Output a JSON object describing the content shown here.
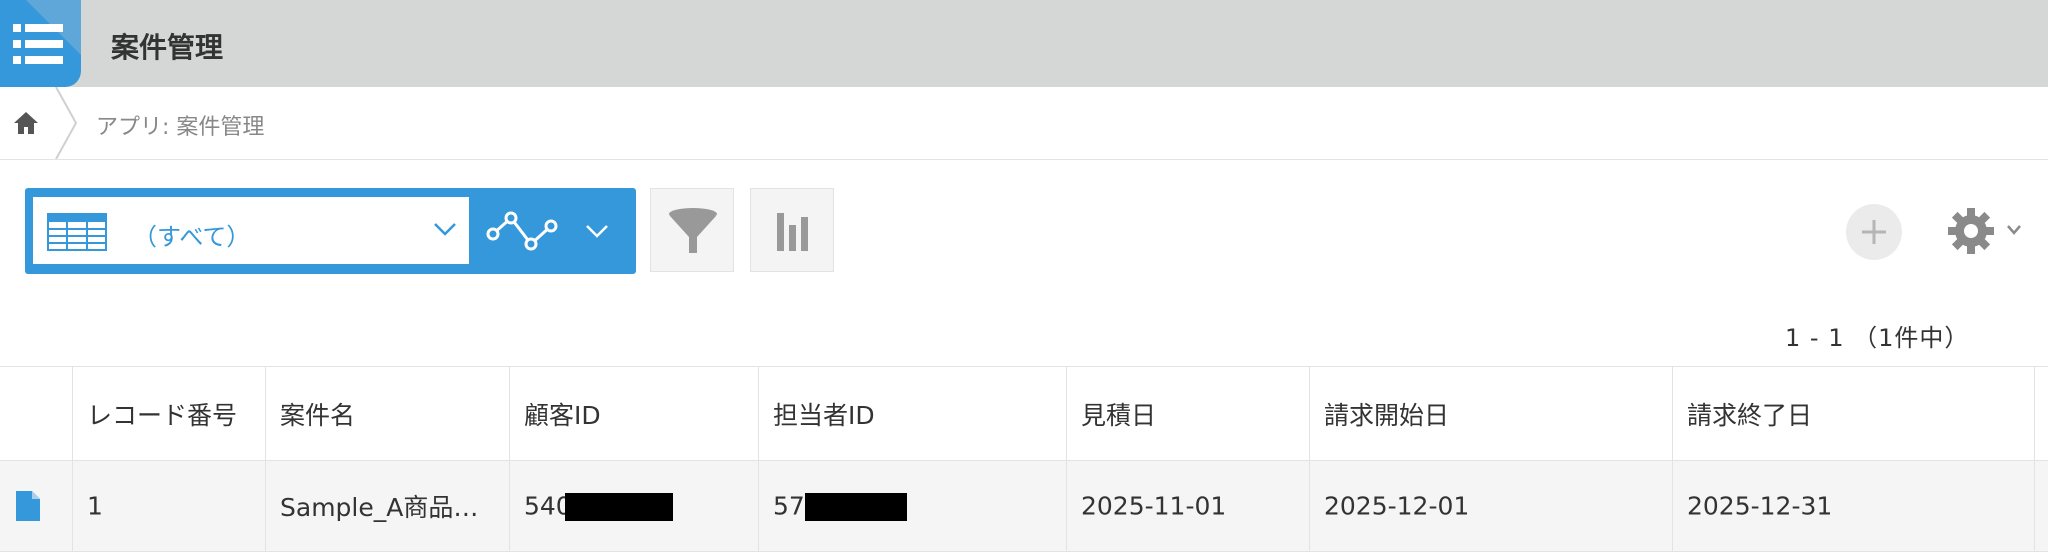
{
  "header": {
    "title": "案件管理",
    "app_icon": "list-icon"
  },
  "breadcrumb": {
    "home_icon": "home-icon",
    "path": "アプリ: 案件管理"
  },
  "toolbar": {
    "view_selected": "（すべて）",
    "icons": [
      "table-view-icon",
      "chevron-down-icon",
      "graph-icon",
      "filter-icon",
      "bar-chart-icon",
      "plus-icon",
      "gear-icon"
    ]
  },
  "pagination": {
    "text": "1 - 1 （1件中）"
  },
  "table": {
    "columns": [
      "レコード番号",
      "案件名",
      "顧客ID",
      "担当者ID",
      "見積日",
      "請求開始日",
      "請求終了日"
    ],
    "rows": [
      {
        "record_no": "1",
        "name": "Sample_A商品…",
        "customer_id": "540",
        "staff_id": "57",
        "estimate_date": "2025-11-01",
        "billing_start": "2025-12-01",
        "billing_end": "2025-12-31"
      }
    ]
  },
  "colors": {
    "accent": "#3498db",
    "header_bg": "#d5d6d6"
  }
}
